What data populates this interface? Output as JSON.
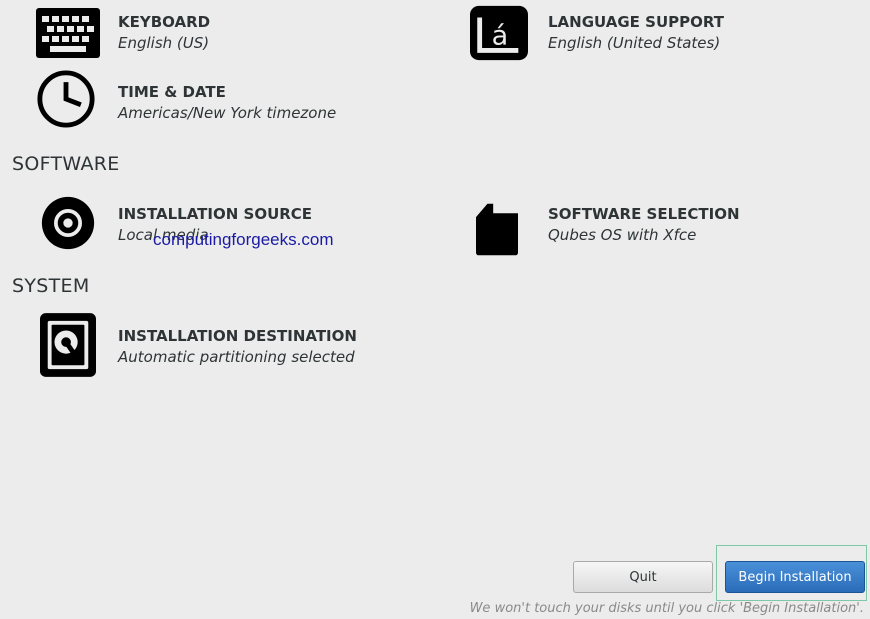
{
  "spokes": {
    "keyboard": {
      "title": "KEYBOARD",
      "status": "English (US)",
      "icon": "keyboard-icon"
    },
    "language": {
      "title": "LANGUAGE SUPPORT",
      "status": "English (United States)",
      "icon": "language-icon"
    },
    "time_date": {
      "title": "TIME & DATE",
      "status": "Americas/New York timezone",
      "icon": "clock-icon"
    },
    "install_source": {
      "title": "INSTALLATION SOURCE",
      "status": "Local media",
      "icon": "disc-icon"
    },
    "software_selection": {
      "title": "SOFTWARE SELECTION",
      "status": "Qubes OS with Xfce",
      "icon": "package-icon"
    },
    "install_destination": {
      "title": "INSTALLATION DESTINATION",
      "status": "Automatic partitioning selected",
      "icon": "harddisk-icon"
    }
  },
  "categories": {
    "software": "SOFTWARE",
    "system": "SYSTEM"
  },
  "watermark": "computingforgeeks.com",
  "buttons": {
    "quit": "Quit",
    "begin": "Begin Installation"
  },
  "footnote": "We won't touch your disks until you click 'Begin Installation'.",
  "colors": {
    "background": "#ececec",
    "accent": "#2a6cb8",
    "watermark": "#1a1aa6"
  }
}
